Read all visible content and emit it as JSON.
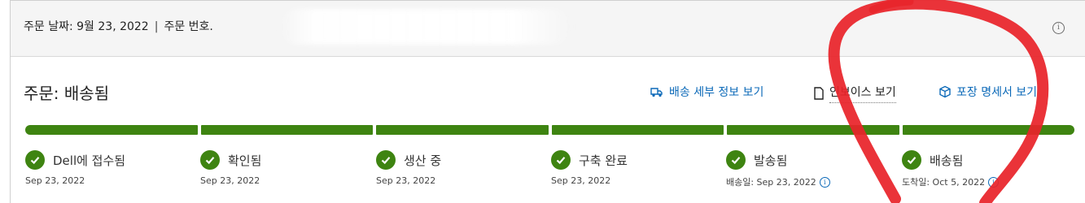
{
  "header": {
    "order_date": "주문 날짜: 9월 23, 2022",
    "separator": "|",
    "order_number_label": "주문 번호."
  },
  "status": {
    "title": "주문: 배송됨"
  },
  "links": {
    "shipping_details": "배송 세부 정보 보기",
    "invoice": "인보이스 보기",
    "packing_slip": "포장 명세서 보기"
  },
  "progress": {
    "completed_segments": 6,
    "total_segments": 6
  },
  "steps": [
    {
      "label": "Dell에 접수됨",
      "date": "Sep 23, 2022"
    },
    {
      "label": "확인됨",
      "date": "Sep 23, 2022"
    },
    {
      "label": "생산 중",
      "date": "Sep 23, 2022"
    },
    {
      "label": "구축 완료",
      "date": "Sep 23, 2022"
    },
    {
      "label": "발송됨",
      "date": "배송일: Sep 23, 2022"
    },
    {
      "label": "배송됨",
      "date": "도착일: Oct 5, 2022"
    }
  ],
  "colors": {
    "accent_green": "#3e8411",
    "link_blue": "#0b69b8",
    "annotation_red": "#e8242a"
  },
  "icons": {
    "info": "info-icon",
    "truck": "truck-icon",
    "document": "document-icon",
    "package": "package-icon",
    "check": "check-circle-icon"
  }
}
